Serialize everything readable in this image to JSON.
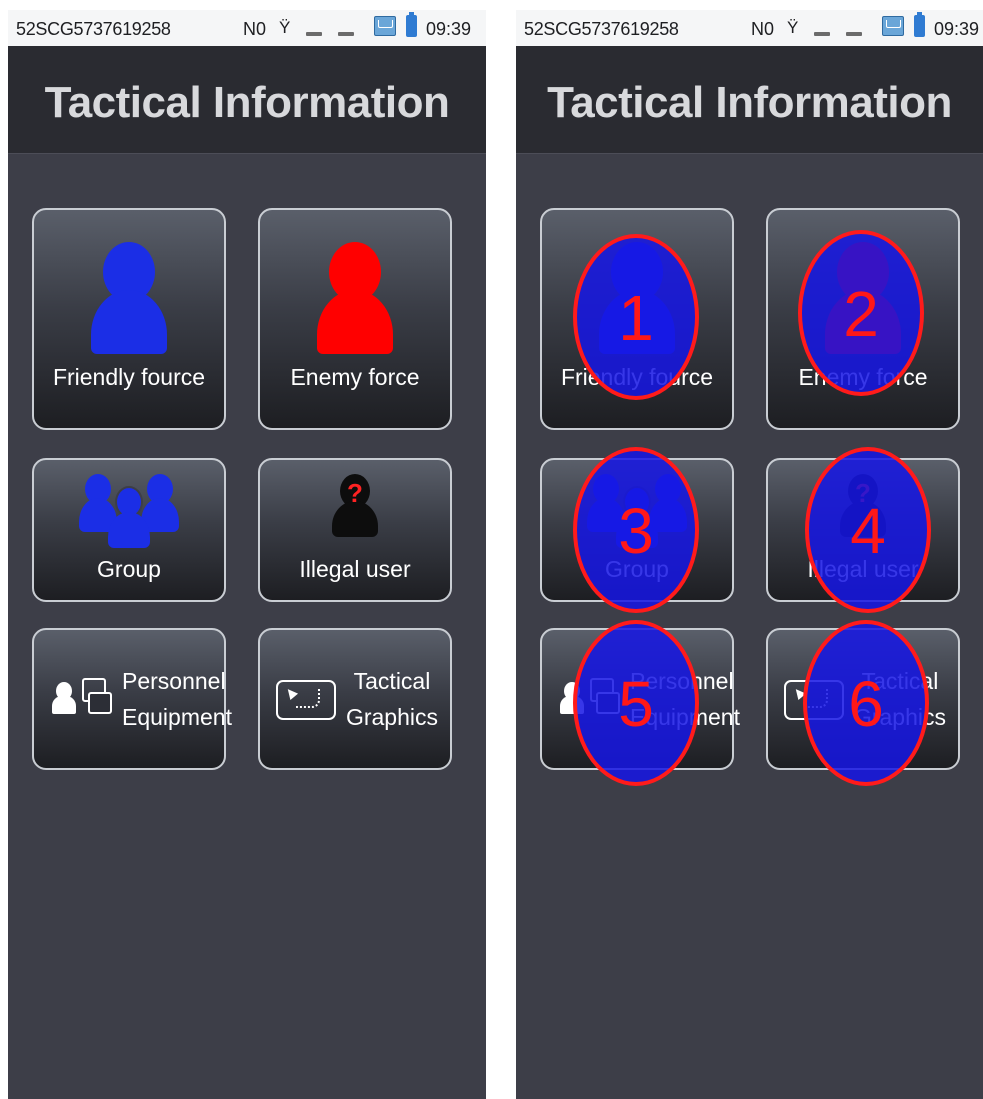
{
  "status_bar": {
    "device_id": "52SCG5737619258",
    "network": "N0",
    "time": "09:39"
  },
  "header": {
    "title": "Tactical Information"
  },
  "tiles": [
    {
      "label": "Friendly fource"
    },
    {
      "label": "Enemy force"
    },
    {
      "label": "Group"
    },
    {
      "label": "Illegal user",
      "question_mark": "?"
    },
    {
      "label_line1": "Personnel",
      "label_line2": "Equipment"
    },
    {
      "label_line1": "Tactical",
      "label_line2": "Graphics"
    }
  ],
  "markers": [
    "1",
    "2",
    "3",
    "4",
    "5",
    "6"
  ],
  "colors": {
    "friendly": "#1b2ee6",
    "enemy": "#ff0000",
    "illegal": "#0d0d0d",
    "marker_fill": "#1616e4",
    "marker_outline": "#ff1b1b"
  },
  "icons": [
    "person-icon",
    "group-icon",
    "unknown-person-icon",
    "personnel-equipment-icon",
    "tactical-graphics-icon"
  ]
}
